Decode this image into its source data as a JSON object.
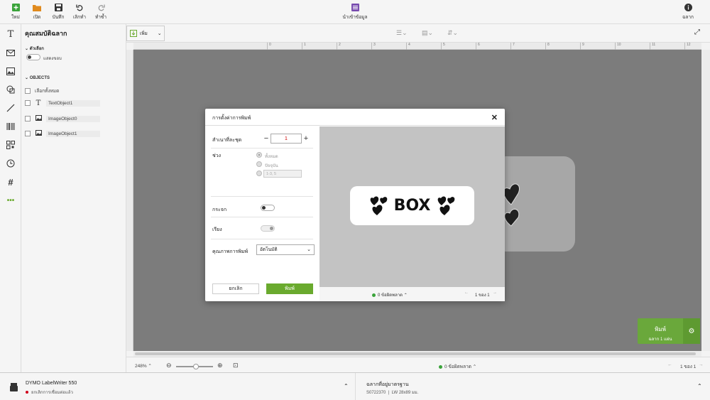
{
  "toolbar": {
    "new": "ใหม่",
    "open": "เปิด",
    "save": "บันทึก",
    "undo": "เลิกทำ",
    "redo": "ทำซ้ำ",
    "import_data": "นำเข้าข้อมูล",
    "label_info": "ฉลาก"
  },
  "props": {
    "title": "คุณสมบัติฉลาก",
    "options_header": "ตัวเลือก",
    "show_border": "แสดงขอบ",
    "objects_header": "OBJECTS",
    "select_all": "เลือกทั้งหมด",
    "objects": [
      {
        "icon": "text-icon",
        "name": "TextObject1"
      },
      {
        "icon": "image-icon",
        "name": "ImageObject0"
      },
      {
        "icon": "image-icon",
        "name": "ImageObject1"
      }
    ]
  },
  "canvas": {
    "add_label": "เพิ่ม",
    "ruler": [
      "0",
      "1",
      "2",
      "3",
      "4",
      "5",
      "6",
      "7",
      "8",
      "9",
      "10",
      "11",
      "12"
    ],
    "zoom": "248%",
    "errors": "0 ข้อผิดพลาด",
    "page": "1 ของ 1"
  },
  "print_float": {
    "label": "พิมพ์",
    "sub": "ฉลาก 1 แผ่น"
  },
  "status": {
    "printer_name": "DYMO LabelWriter 550",
    "printer_state": "ยกเลิกการเชื่อมต่อแล้ว",
    "label_type": "ฉลากที่อยู่มาตรฐาน",
    "label_code": "S0722370",
    "label_size": "LW 28x89 มม."
  },
  "dialog": {
    "title": "การตั้งค่าการพิมพ์",
    "copies_label": "สำเนาที่ละชุด",
    "copies_value": "1",
    "range_label": "ช่วง",
    "range_all": "ทั้งหมด",
    "range_current": "ปัจจุบัน",
    "range_placeholder": "1-3, 5",
    "mirror_label": "กระจก",
    "collate_label": "เรียง",
    "quality_label": "คุณภาพการพิมพ์",
    "quality_value": "อัตโนมัติ",
    "cancel": "ยกเลิก",
    "print": "พิมพ์",
    "preview_text": "BOX",
    "errors": "0 ข้อผิดพลาด",
    "page": "1 ของ 1"
  },
  "colors": {
    "accent_green": "#6aaa2e",
    "status_green": "#3aa33a",
    "status_red": "#d0021b"
  }
}
